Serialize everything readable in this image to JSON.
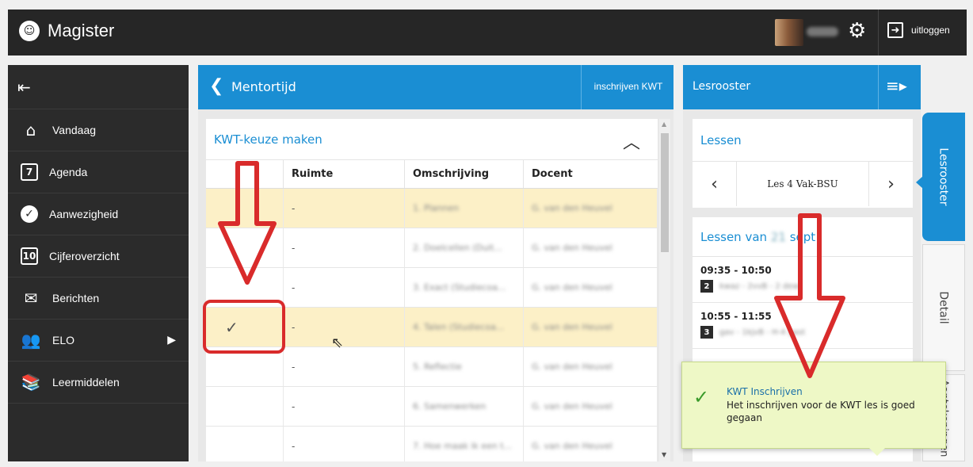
{
  "app": {
    "title": "Magister"
  },
  "topbar": {
    "logout_label": "uitloggen"
  },
  "sidebar": {
    "items": [
      {
        "label": "Vandaag",
        "icon": "home-icon"
      },
      {
        "label": "Agenda",
        "icon": "calendar-icon",
        "icon_text": "7"
      },
      {
        "label": "Aanwezigheid",
        "icon": "check-circle-icon"
      },
      {
        "label": "Cijferoverzicht",
        "icon": "grade-icon",
        "icon_text": "10"
      },
      {
        "label": "Berichten",
        "icon": "envelope-icon"
      },
      {
        "label": "ELO",
        "icon": "people-icon"
      },
      {
        "label": "Leermiddelen",
        "icon": "books-icon"
      }
    ]
  },
  "main": {
    "title": "Mentortijd",
    "action_label": "inschrijven KWT",
    "card_title": "KWT-keuze maken",
    "columns": [
      "",
      "Ruimte",
      "Omschrijving",
      "Docent"
    ],
    "rows": [
      {
        "ruimte": "-",
        "omschrijving": "1. Plannen",
        "docent": "G. van den Heuvel",
        "highlighted": true,
        "selected": false
      },
      {
        "ruimte": "-",
        "omschrijving": "2. Doelcellen (Duit...",
        "docent": "G. van den Heuvel",
        "highlighted": false,
        "selected": false
      },
      {
        "ruimte": "-",
        "omschrijving": "3. Exact (Studiecoa...",
        "docent": "G. van den Heuvel",
        "highlighted": false,
        "selected": false
      },
      {
        "ruimte": "-",
        "omschrijving": "4. Talen (Studiecoa...",
        "docent": "G. van den Heuvel",
        "highlighted": true,
        "selected": true
      },
      {
        "ruimte": "-",
        "omschrijving": "5. Reflectie",
        "docent": "G. van den Heuvel",
        "highlighted": false,
        "selected": false
      },
      {
        "ruimte": "-",
        "omschrijving": "6. Samenwerken",
        "docent": "G. van den Heuvel",
        "highlighted": false,
        "selected": false
      },
      {
        "ruimte": "-",
        "omschrijving": "7. Hoe maak ik een t...",
        "docent": "G. van den Heuvel",
        "highlighted": false,
        "selected": false
      }
    ]
  },
  "rightpanel": {
    "title": "Lesrooster",
    "lessons_title": "Lessen",
    "lesson_nav_label": "Les 4 Vak-BSU",
    "lessons_of_prefix": "Lessen van",
    "lessons_of_date": "21",
    "lessons_of_suffix": "sept",
    "lessons": [
      {
        "time": "09:35 - 10:50",
        "number": "2",
        "desc": "kwaz - 2vvB - 2 dew"
      },
      {
        "time": "10:55 - 11:55",
        "number": "3",
        "desc": "gav - 1kjvB - H-4 gast"
      }
    ]
  },
  "tabs": [
    "Lesrooster",
    "Detail",
    "Aantekeningen"
  ],
  "toast": {
    "title": "KWT Inschrijven",
    "message": "Het inschrijven voor de KWT les is goed gegaan"
  },
  "colors": {
    "accent": "#1a8ed3",
    "topbar": "#262626",
    "sidebar": "#2b2b2b",
    "highlight_row": "#fcf0c7",
    "annotation": "#d92b2b",
    "toast_bg": "#eef8c6"
  }
}
